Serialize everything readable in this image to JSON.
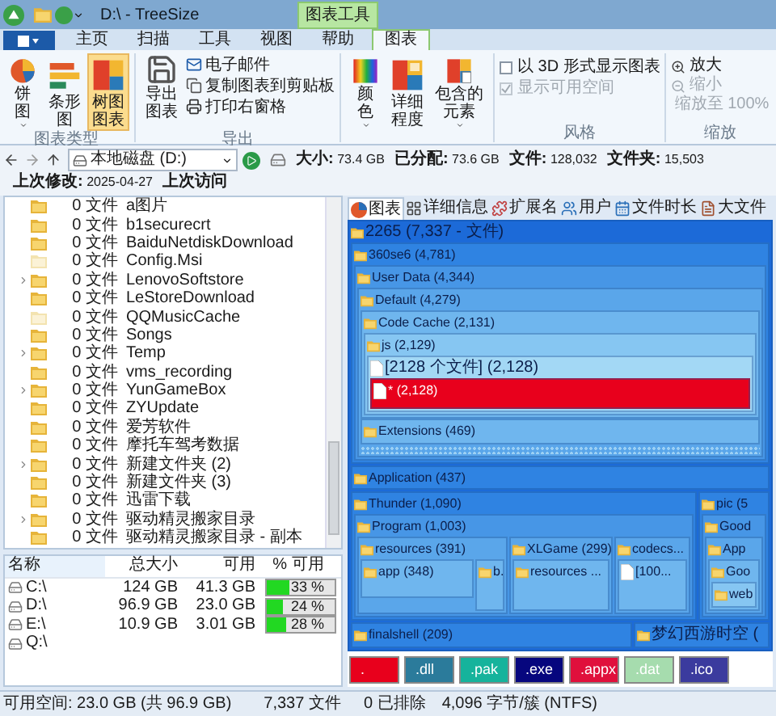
{
  "window": {
    "title": "D:\\ - TreeSize",
    "context_tab": "图表工具"
  },
  "menu_tabs": [
    {
      "label": "主页",
      "selected": false
    },
    {
      "label": "扫描",
      "selected": false
    },
    {
      "label": "工具",
      "selected": false
    },
    {
      "label": "视图",
      "selected": false
    },
    {
      "label": "帮助",
      "selected": false
    },
    {
      "label": "图表",
      "selected": true
    }
  ],
  "ribbon": {
    "chart_type": {
      "label": "图表类型",
      "buttons": [
        {
          "label": "饼图",
          "dropdown": true,
          "selected": false
        },
        {
          "label": "条形图",
          "dropdown": false,
          "selected": false
        },
        {
          "label": "树图图表",
          "dropdown": false,
          "selected": true
        }
      ]
    },
    "export": {
      "label": "导出",
      "big_button": "导出图表",
      "small_buttons": [
        "电子邮件",
        "复制图表到剪贴板",
        "打印右窗格"
      ]
    },
    "appearance": {
      "buttons": [
        {
          "label": "颜色",
          "dropdown": true
        },
        {
          "label": "详细程度",
          "dropdown": false
        },
        {
          "label": "包含的元素",
          "dropdown": true
        }
      ]
    },
    "style": {
      "label": "风格",
      "options": [
        {
          "label": "以 3D 形式显示图表",
          "checked": false,
          "disabled": false
        },
        {
          "label": "显示可用空间",
          "checked": true,
          "disabled": true
        }
      ]
    },
    "zoom": {
      "label": "缩放",
      "buttons": [
        {
          "label": "放大",
          "disabled": false
        },
        {
          "label": "缩小",
          "disabled": true
        },
        {
          "label": "缩放至 100%",
          "disabled": true
        }
      ]
    }
  },
  "address": {
    "location": "本地磁盘 (D:)"
  },
  "stats": [
    {
      "label": "大小:",
      "value": "73.4 GB"
    },
    {
      "label": "已分配:",
      "value": "73.6 GB"
    },
    {
      "label": "文件:",
      "value": "128,032"
    },
    {
      "label": "文件夹:",
      "value": "15,503"
    },
    {
      "label": "上次修改:",
      "value": "2025-04-27"
    },
    {
      "label": "上次访问"
    }
  ],
  "tree": [
    {
      "count": "0 文件",
      "name": "a图片",
      "expandable": false,
      "hidden": false
    },
    {
      "count": "0 文件",
      "name": "b1securecrt",
      "expandable": false,
      "hidden": false
    },
    {
      "count": "0 文件",
      "name": "BaiduNetdiskDownload",
      "expandable": false,
      "hidden": false
    },
    {
      "count": "0 文件",
      "name": "Config.Msi",
      "expandable": false,
      "hidden": true
    },
    {
      "count": "0 文件",
      "name": "LenovoSoftstore",
      "expandable": true,
      "hidden": false
    },
    {
      "count": "0 文件",
      "name": "LeStoreDownload",
      "expandable": false,
      "hidden": false
    },
    {
      "count": "0 文件",
      "name": "QQMusicCache",
      "expandable": false,
      "hidden": true
    },
    {
      "count": "0 文件",
      "name": "Songs",
      "expandable": false,
      "hidden": false
    },
    {
      "count": "0 文件",
      "name": "Temp",
      "expandable": true,
      "hidden": false
    },
    {
      "count": "0 文件",
      "name": "vms_recording",
      "expandable": false,
      "hidden": false
    },
    {
      "count": "0 文件",
      "name": "YunGameBox",
      "expandable": true,
      "hidden": false
    },
    {
      "count": "0 文件",
      "name": "ZYUpdate",
      "expandable": false,
      "hidden": false
    },
    {
      "count": "0 文件",
      "name": "爱芳软件",
      "expandable": false,
      "hidden": false
    },
    {
      "count": "0 文件",
      "name": "摩托车驾考数据",
      "expandable": false,
      "hidden": false
    },
    {
      "count": "0 文件",
      "name": "新建文件夹 (2)",
      "expandable": true,
      "hidden": false
    },
    {
      "count": "0 文件",
      "name": "新建文件夹 (3)",
      "expandable": false,
      "hidden": false
    },
    {
      "count": "0 文件",
      "name": "迅雷下载",
      "expandable": false,
      "hidden": false
    },
    {
      "count": "0 文件",
      "name": "驱动精灵搬家目录",
      "expandable": true,
      "hidden": false
    },
    {
      "count": "0 文件",
      "name": "驱动精灵搬家目录 - 副本",
      "expandable": false,
      "hidden": false
    }
  ],
  "drives": {
    "columns": [
      "名称",
      "总大小",
      "可用",
      "% 可用"
    ],
    "rows": [
      {
        "name": "C:\\",
        "total": "124 GB",
        "free": "41.3 GB",
        "percent": "33 %",
        "level": 0.33
      },
      {
        "name": "D:\\",
        "total": "96.9 GB",
        "free": "23.0 GB",
        "percent": "24 %",
        "level": 0.24
      },
      {
        "name": "E:\\",
        "total": "10.9 GB",
        "free": "3.01 GB",
        "percent": "28 %",
        "level": 0.28
      },
      {
        "name": "Q:\\"
      }
    ]
  },
  "view_tabs": [
    {
      "label": "图表",
      "selected": true
    },
    {
      "label": "详细信息",
      "selected": false
    },
    {
      "label": "扩展名",
      "selected": false
    },
    {
      "label": "用户",
      "selected": false
    },
    {
      "label": "文件时长",
      "selected": false
    },
    {
      "label": "大文件",
      "selected": false
    }
  ],
  "treemap": {
    "label": "2265 (7,337 - 文件)",
    "children": [
      {
        "label": "360se6 (4,781)",
        "children": [
          {
            "label": "User Data (4,344)",
            "children": [
              {
                "label": "Default (4,279)",
                "children": [
                  {
                    "label": "Code Cache (2,131)",
                    "children": [
                      {
                        "label": "js (2,129)",
                        "children": [
                          {
                            "label": "[2128 个文件] (2,128)",
                            "kind": "files",
                            "children": [
                              {
                                "label": "* (2,128)",
                                "kind": "file"
                              }
                            ]
                          }
                        ]
                      }
                    ]
                  },
                  {
                    "label": "Extensions (469)"
                  }
                ]
              }
            ]
          }
        ]
      },
      {
        "label": "Application (437)"
      },
      {
        "label": "Thunder (1,090)",
        "children": [
          {
            "label": "Program (1,003)",
            "children": [
              {
                "label": "resources (391)",
                "children": [
                  {
                    "label": "app (348)"
                  },
                  {
                    "label": "b."
                  }
                ]
              },
              {
                "label": "XLGame (299)",
                "children": [
                  {
                    "label": "resources ..."
                  }
                ]
              },
              {
                "label": "codecs...",
                "children": [
                  {
                    "label": "[100...",
                    "kind": "files"
                  }
                ]
              }
            ]
          }
        ]
      },
      {
        "label": "pic (5",
        "children": [
          {
            "label": "Good",
            "children": [
              {
                "label": "App",
                "children": [
                  {
                    "label": "Goo",
                    "children": [
                      {
                        "label": "web"
                      }
                    ]
                  }
                ]
              }
            ]
          }
        ]
      },
      {
        "label": "finalshell (209)"
      },
      {
        "label": "梦幻西游时空 ("
      }
    ]
  },
  "legend": [
    {
      "label": ".",
      "color": "#e8001c"
    },
    {
      "label": ".dll",
      "color": "#2b7b9b"
    },
    {
      "label": ".pak",
      "color": "#16b39c"
    },
    {
      "label": ".exe",
      "color": "#06067e"
    },
    {
      "label": ".appx",
      "color": "#e0103c"
    },
    {
      "label": ".dat",
      "color": "#a6dcae"
    },
    {
      "label": ".ico",
      "color": "#3b3b9e"
    }
  ],
  "status_bar": [
    "可用空间: 23.0 GB  (共 96.9 GB)",
    "7,337 文件",
    "0 已排除",
    "4,096 字节/簇 (NTFS)"
  ]
}
